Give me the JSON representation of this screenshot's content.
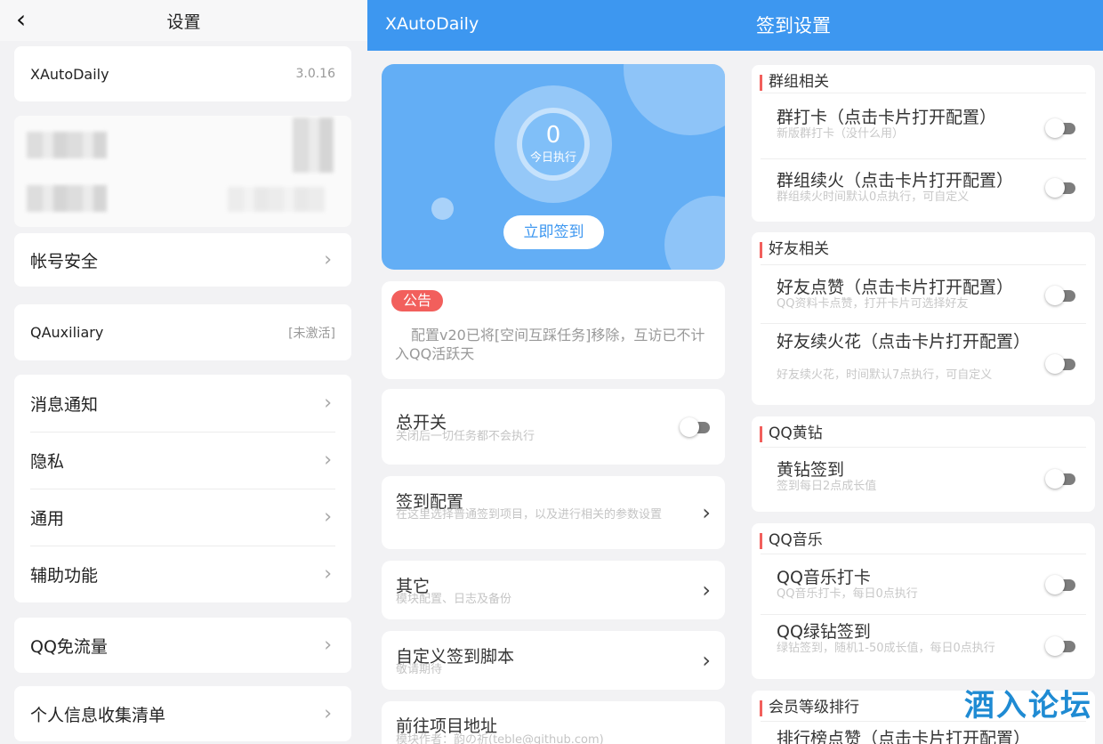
{
  "left": {
    "title": "设置",
    "account": {
      "name": "XAutoDaily",
      "version": "3.0.16"
    },
    "security": "帐号安全",
    "qauxiliary": {
      "label": "QAuxiliary",
      "status": "[未激活]"
    },
    "group_items": [
      "消息通知",
      "隐私",
      "通用",
      "辅助功能"
    ],
    "free_data": "QQ免流量",
    "personal_info": "个人信息收集清单"
  },
  "middle": {
    "app_title": "XAutoDaily",
    "today_count": "0",
    "today_label": "今日执行",
    "sign_button": "立即签到",
    "notice_badge": "公告",
    "notice_text": "配置v20已将[空间互踩任务]移除，互访已不计入QQ活跃天",
    "master_switch": {
      "title": "总开关",
      "subtitle": "关闭后一切任务都不会执行"
    },
    "sign_config": {
      "title": "签到配置",
      "subtitle": "在这里选择普通签到项目，以及进行相关的参数设置"
    },
    "other": {
      "title": "其它",
      "subtitle": "模块配置、日志及备份"
    },
    "custom_script": {
      "title": "自定义签到脚本",
      "subtitle": "敬请期待"
    },
    "project": {
      "title": "前往项目地址",
      "subtitle": "模块作者：韵の祈(teble@github.com)"
    }
  },
  "right": {
    "app_title": "签到设置",
    "sections": {
      "group": {
        "header": "群组相关",
        "items": [
          {
            "title": "群打卡（点击卡片打开配置）",
            "subtitle": "新版群打卡（没什么用）"
          },
          {
            "title": "群组续火（点击卡片打开配置）",
            "subtitle": "群组续火时间默认0点执行，可自定义"
          }
        ]
      },
      "friend": {
        "header": "好友相关",
        "items": [
          {
            "title": "好友点赞（点击卡片打开配置）",
            "subtitle": "QQ资料卡点赞，打开卡片可选择好友"
          },
          {
            "title": "好友续火花（点击卡片打开配置）",
            "subtitle": "好友续火花，时间默认7点执行，可自定义"
          }
        ]
      },
      "yellow": {
        "header": "QQ黄钻",
        "items": [
          {
            "title": "黄钻签到",
            "subtitle": "签到每日2点成长值"
          }
        ]
      },
      "music": {
        "header": "QQ音乐",
        "items": [
          {
            "title": "QQ音乐打卡",
            "subtitle": "QQ音乐打卡，每日0点执行"
          },
          {
            "title": "QQ绿钻签到",
            "subtitle": "绿钻签到，随机1-50成长值，每日0点执行"
          }
        ]
      },
      "vip": {
        "header": "会员等级排行",
        "items": [
          {
            "title": "排行榜点赞（点击卡片打开配置）"
          }
        ]
      }
    }
  },
  "watermark": "酒入论坛"
}
